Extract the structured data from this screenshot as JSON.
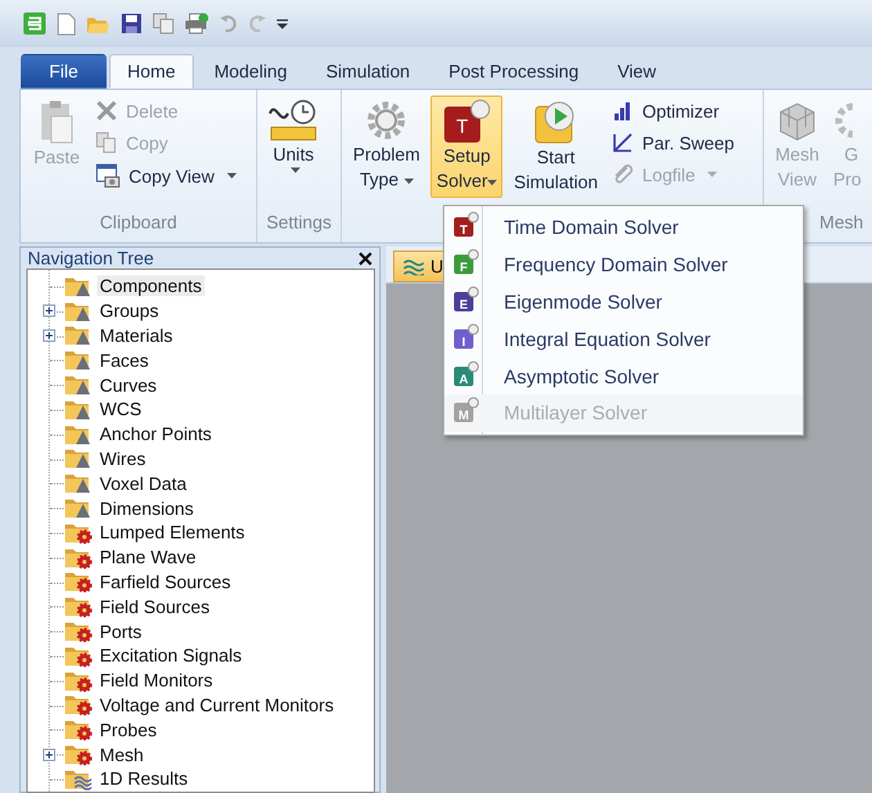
{
  "tabs": [
    {
      "label": "File",
      "kind": "file",
      "selected": false
    },
    {
      "label": "Home",
      "kind": "normal",
      "selected": true
    },
    {
      "label": "Modeling",
      "kind": "normal",
      "selected": false
    },
    {
      "label": "Simulation",
      "kind": "normal",
      "selected": false
    },
    {
      "label": "Post Processing",
      "kind": "normal",
      "selected": false
    },
    {
      "label": "View",
      "kind": "normal",
      "selected": false
    }
  ],
  "ribbon": {
    "clipboard": {
      "label": "Clipboard",
      "paste": {
        "label": "Paste",
        "disabled": true
      },
      "delete": {
        "label": "Delete",
        "disabled": true
      },
      "copy": {
        "label": "Copy",
        "disabled": true
      },
      "copy_view": {
        "label": "Copy View",
        "disabled": false
      }
    },
    "settings": {
      "label": "Settings",
      "units": {
        "label": "Units"
      }
    },
    "simulation": {
      "problem_type": {
        "lines": [
          "Problem",
          "Type"
        ]
      },
      "setup_solver": {
        "lines": [
          "Setup",
          "Solver"
        ],
        "icon_letter": "T",
        "open": true
      },
      "start_simulation": {
        "lines": [
          "Start",
          "Simulation"
        ]
      },
      "optimizer": {
        "label": "Optimizer",
        "disabled": false
      },
      "par_sweep": {
        "label": "Par. Sweep",
        "disabled": false
      },
      "logfile": {
        "label": "Logfile",
        "disabled": true
      }
    },
    "mesh": {
      "label": "Mesh",
      "mesh_view": {
        "lines": [
          "Mesh",
          "View"
        ],
        "disabled": true
      },
      "cut_button": {
        "lines": [
          "G",
          "Pro"
        ],
        "disabled": true
      }
    }
  },
  "navigation_tree": {
    "title": "Navigation Tree",
    "items": [
      {
        "label": "Components",
        "kind": "model",
        "expandable": false,
        "selected": true
      },
      {
        "label": "Groups",
        "kind": "model",
        "expandable": true,
        "selected": false
      },
      {
        "label": "Materials",
        "kind": "model",
        "expandable": true,
        "selected": false
      },
      {
        "label": "Faces",
        "kind": "model",
        "expandable": false,
        "selected": false
      },
      {
        "label": "Curves",
        "kind": "model",
        "expandable": false,
        "selected": false
      },
      {
        "label": "WCS",
        "kind": "model",
        "expandable": false,
        "selected": false
      },
      {
        "label": "Anchor Points",
        "kind": "model",
        "expandable": false,
        "selected": false
      },
      {
        "label": "Wires",
        "kind": "model",
        "expandable": false,
        "selected": false
      },
      {
        "label": "Voxel Data",
        "kind": "model",
        "expandable": false,
        "selected": false
      },
      {
        "label": "Dimensions",
        "kind": "model",
        "expandable": false,
        "selected": false
      },
      {
        "label": "Lumped Elements",
        "kind": "source",
        "expandable": false,
        "selected": false
      },
      {
        "label": "Plane Wave",
        "kind": "source",
        "expandable": false,
        "selected": false
      },
      {
        "label": "Farfield Sources",
        "kind": "source",
        "expandable": false,
        "selected": false
      },
      {
        "label": "Field Sources",
        "kind": "source",
        "expandable": false,
        "selected": false
      },
      {
        "label": "Ports",
        "kind": "source",
        "expandable": false,
        "selected": false
      },
      {
        "label": "Excitation Signals",
        "kind": "source",
        "expandable": false,
        "selected": false
      },
      {
        "label": "Field Monitors",
        "kind": "source",
        "expandable": false,
        "selected": false
      },
      {
        "label": "Voltage and Current Monitors",
        "kind": "source",
        "expandable": false,
        "selected": false
      },
      {
        "label": "Probes",
        "kind": "source",
        "expandable": false,
        "selected": false
      },
      {
        "label": "Mesh",
        "kind": "source",
        "expandable": true,
        "selected": false
      },
      {
        "label": "1D Results",
        "kind": "result",
        "expandable": false,
        "selected": false
      }
    ]
  },
  "document_tab": {
    "label": "U"
  },
  "solver_menu": [
    {
      "label": "Time Domain Solver",
      "letter": "T",
      "color": "#a11f1f",
      "disabled": false
    },
    {
      "label": "Frequency Domain Solver",
      "letter": "F",
      "color": "#3c9c3c",
      "disabled": false
    },
    {
      "label": "Eigenmode Solver",
      "letter": "E",
      "color": "#4b3f98",
      "disabled": false
    },
    {
      "label": "Integral Equation Solver",
      "letter": "I",
      "color": "#6f5fcc",
      "disabled": false
    },
    {
      "label": "Asymptotic Solver",
      "letter": "A",
      "color": "#2a8c78",
      "disabled": false
    },
    {
      "label": "Multilayer Solver",
      "letter": "M",
      "color": "#a2a2a2",
      "disabled": true
    }
  ]
}
